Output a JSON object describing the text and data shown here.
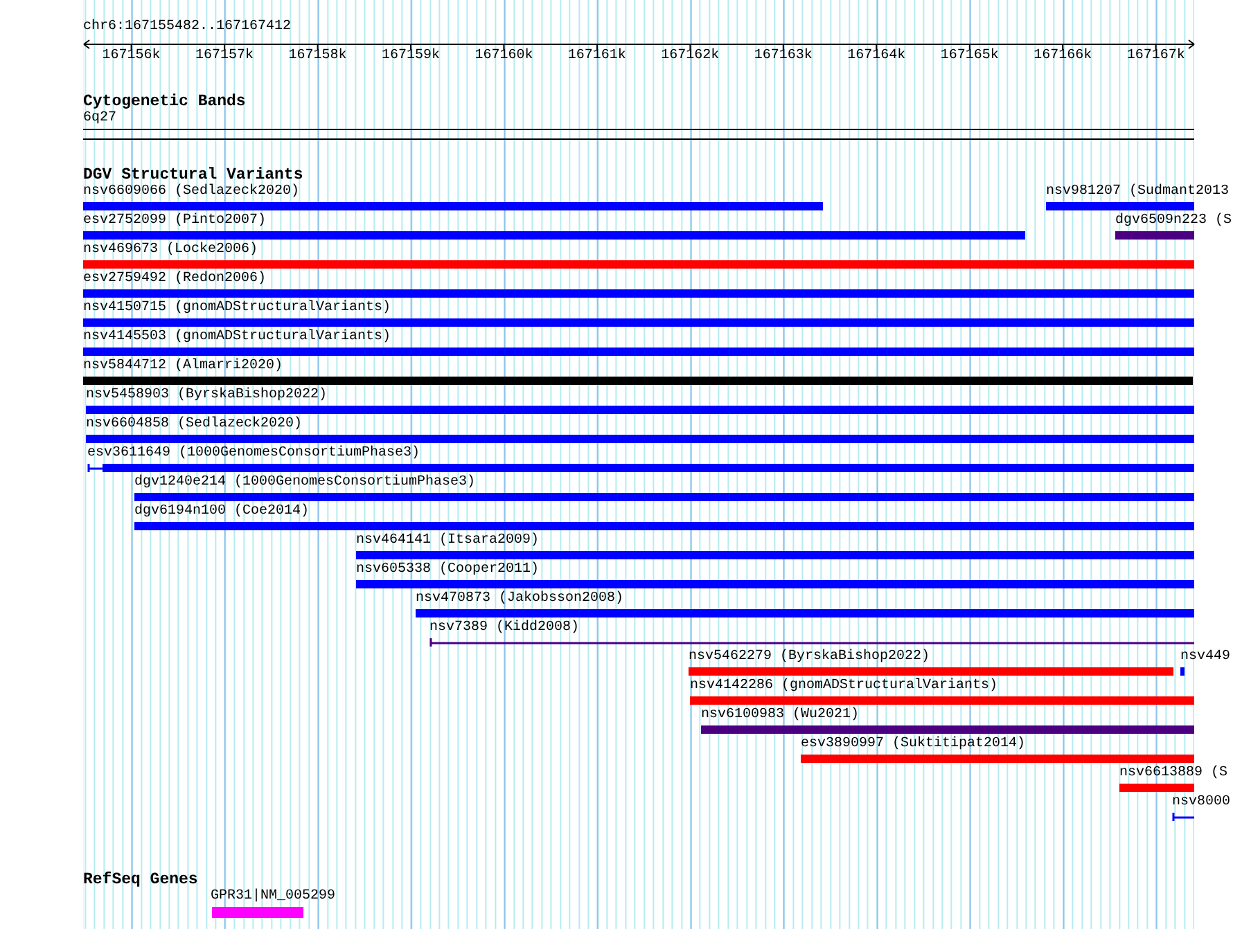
{
  "locus": "chr6:167155482..167167412",
  "ruler": {
    "ticks": [
      "167156k",
      "167157k",
      "167158k",
      "167159k",
      "167160k",
      "167161k",
      "167162k",
      "167163k",
      "167164k",
      "167165k",
      "167166k",
      "167167k"
    ]
  },
  "tracks": [
    {
      "kind": "bands",
      "title": "Cytogenetic Bands",
      "band": "6q27"
    },
    {
      "kind": "variants",
      "title": "DGV Structural Variants",
      "rows": [
        {
          "features": [
            {
              "label": "nsv6609066 (Sedlazeck2020)",
              "color": "#0000ff",
              "kind": "bar"
            },
            {
              "label": "nsv981207 (Sudmant2013",
              "color": "#0000ff",
              "kind": "bar"
            }
          ]
        },
        {
          "features": [
            {
              "label": "esv2752099 (Pinto2007)",
              "color": "#0000ff",
              "kind": "bar"
            },
            {
              "label": "dgv6509n223 (S",
              "color": "#4b0082",
              "kind": "bar"
            }
          ]
        },
        {
          "features": [
            {
              "label": "nsv469673 (Locke2006)",
              "color": "#ff0000",
              "kind": "bar"
            }
          ]
        },
        {
          "features": [
            {
              "label": "esv2759492 (Redon2006)",
              "color": "#0000ff",
              "kind": "bar"
            }
          ]
        },
        {
          "features": [
            {
              "label": "nsv4150715 (gnomADStructuralVariants)",
              "color": "#0000ff",
              "kind": "bar"
            }
          ]
        },
        {
          "features": [
            {
              "label": "nsv4145503 (gnomADStructuralVariants)",
              "color": "#0000ff",
              "kind": "bar"
            }
          ]
        },
        {
          "features": [
            {
              "label": "nsv5844712 (Almarri2020)",
              "color": "#000000",
              "kind": "bar"
            }
          ]
        },
        {
          "features": [
            {
              "label": "nsv5458903 (ByrskaBishop2022)",
              "color": "#0000ff",
              "kind": "bar"
            }
          ]
        },
        {
          "features": [
            {
              "label": "nsv6604858 (Sedlazeck2020)",
              "color": "#0000ff",
              "kind": "bar"
            }
          ]
        },
        {
          "features": [
            {
              "label": "esv3611649 (1000GenomesConsortiumPhase3)",
              "color": "#0000ff",
              "kind": "tailed"
            }
          ]
        },
        {
          "features": [
            {
              "label": "dgv1240e214 (1000GenomesConsortiumPhase3)",
              "color": "#0000ff",
              "kind": "bar"
            }
          ]
        },
        {
          "features": [
            {
              "label": "dgv6194n100 (Coe2014)",
              "color": "#0000ff",
              "kind": "bar"
            }
          ]
        },
        {
          "features": [
            {
              "label": "nsv464141 (Itsara2009)",
              "color": "#0000ff",
              "kind": "bar"
            }
          ]
        },
        {
          "features": [
            {
              "label": "nsv605338 (Cooper2011)",
              "color": "#0000ff",
              "kind": "bar"
            }
          ]
        },
        {
          "features": [
            {
              "label": "nsv470873 (Jakobsson2008)",
              "color": "#0000ff",
              "kind": "bar"
            }
          ]
        },
        {
          "features": [
            {
              "label": "nsv7389 (Kidd2008)",
              "color": "#4b0082",
              "kind": "line"
            }
          ]
        },
        {
          "features": [
            {
              "label": "nsv5462279 (ByrskaBishop2022)",
              "color": "#ff0000",
              "kind": "bar"
            },
            {
              "label": "nsv449",
              "color": "#0000ff",
              "kind": "bar"
            }
          ]
        },
        {
          "features": [
            {
              "label": "nsv4142286 (gnomADStructuralVariants)",
              "color": "#ff0000",
              "kind": "bar"
            }
          ]
        },
        {
          "features": [
            {
              "label": "nsv6100983 (Wu2021)",
              "color": "#4b0082",
              "kind": "bar"
            }
          ]
        },
        {
          "features": [
            {
              "label": "esv3890997 (Suktitipat2014)",
              "color": "#ff0000",
              "kind": "bar"
            }
          ]
        },
        {
          "features": [
            {
              "label": "nsv6613889 (S",
              "color": "#ff0000",
              "kind": "bar"
            }
          ]
        },
        {
          "features": [
            {
              "label": "nsv8000",
              "color": "#0000ff",
              "kind": "line"
            }
          ]
        }
      ]
    },
    {
      "kind": "genes",
      "title": "RefSeq Genes",
      "genes": [
        {
          "label": "GPR31|NM_005299"
        }
      ]
    }
  ]
}
